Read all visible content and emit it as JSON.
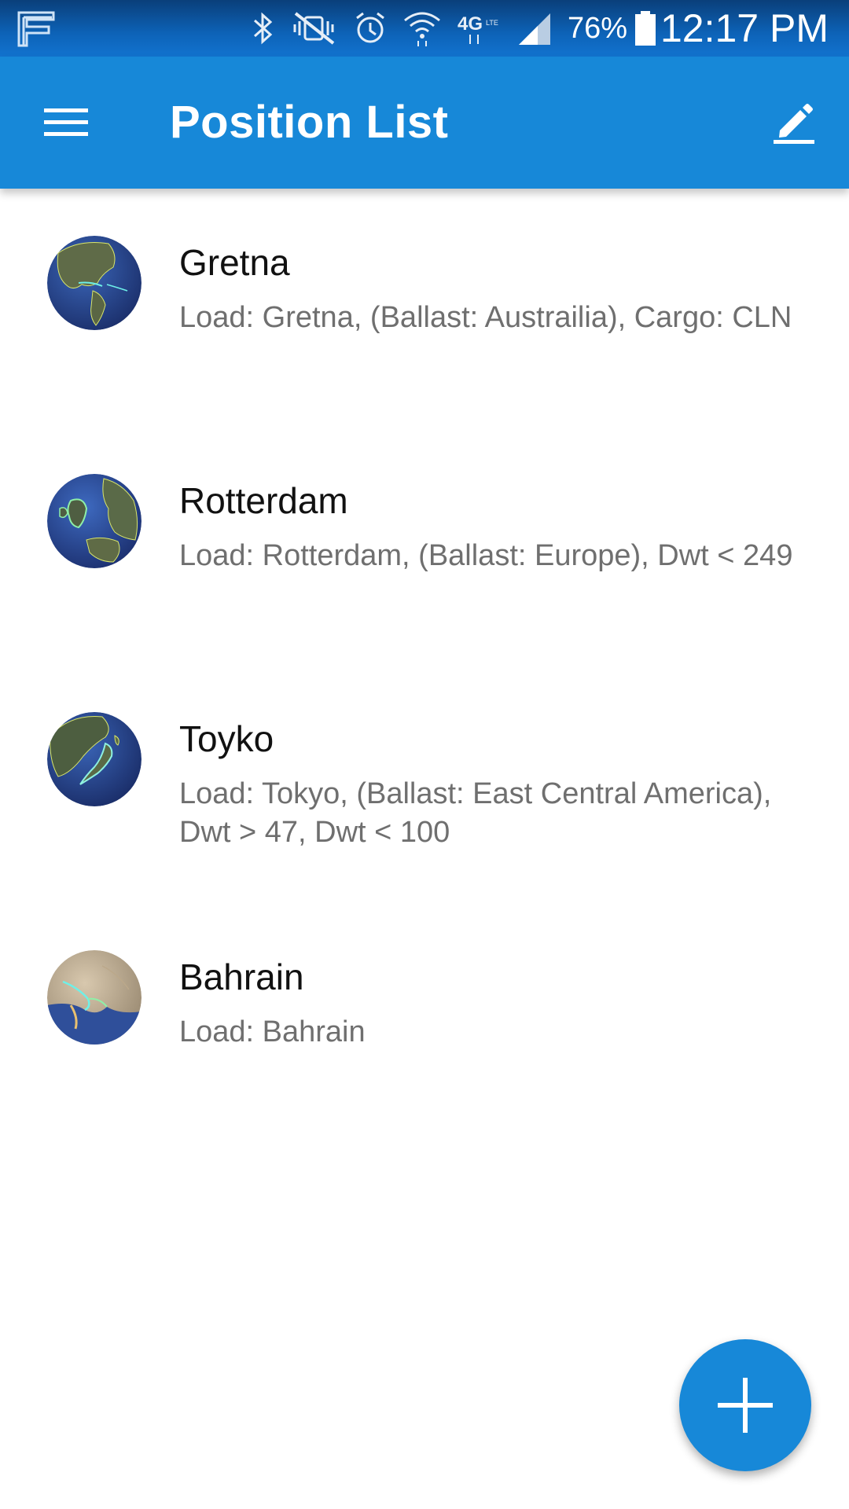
{
  "status_bar": {
    "app_icon": "flightradar-f-icon",
    "icons": [
      "bluetooth-icon",
      "vibrate-mute-icon",
      "alarm-icon",
      "wifi-icon",
      "4g-lte-icon",
      "signal-icon",
      "battery-icon"
    ],
    "battery_percent": "76%",
    "time": "12:17 PM"
  },
  "app_bar": {
    "title": "Position List",
    "menu_icon": "hamburger-menu-icon",
    "edit_icon": "pencil-edit-icon",
    "background": "#1788d8"
  },
  "positions": [
    {
      "title": "Gretna",
      "subtitle": "Load: Gretna, (Ballast: Austrailia), Cargo: CLN",
      "icon": "globe-americas-icon"
    },
    {
      "title": "Rotterdam",
      "subtitle": "Load: Rotterdam, (Ballast: Europe), Dwt < 249",
      "icon": "globe-europe-icon"
    },
    {
      "title": "Toyko",
      "subtitle": "Load: Tokyo, (Ballast: East Central America), Dwt > 47, Dwt < 100",
      "icon": "globe-japan-icon"
    },
    {
      "title": "Bahrain",
      "subtitle": "Load: Bahrain",
      "icon": "globe-middle-east-icon"
    }
  ],
  "fab": {
    "icon": "plus-icon",
    "color": "#1788d8"
  }
}
